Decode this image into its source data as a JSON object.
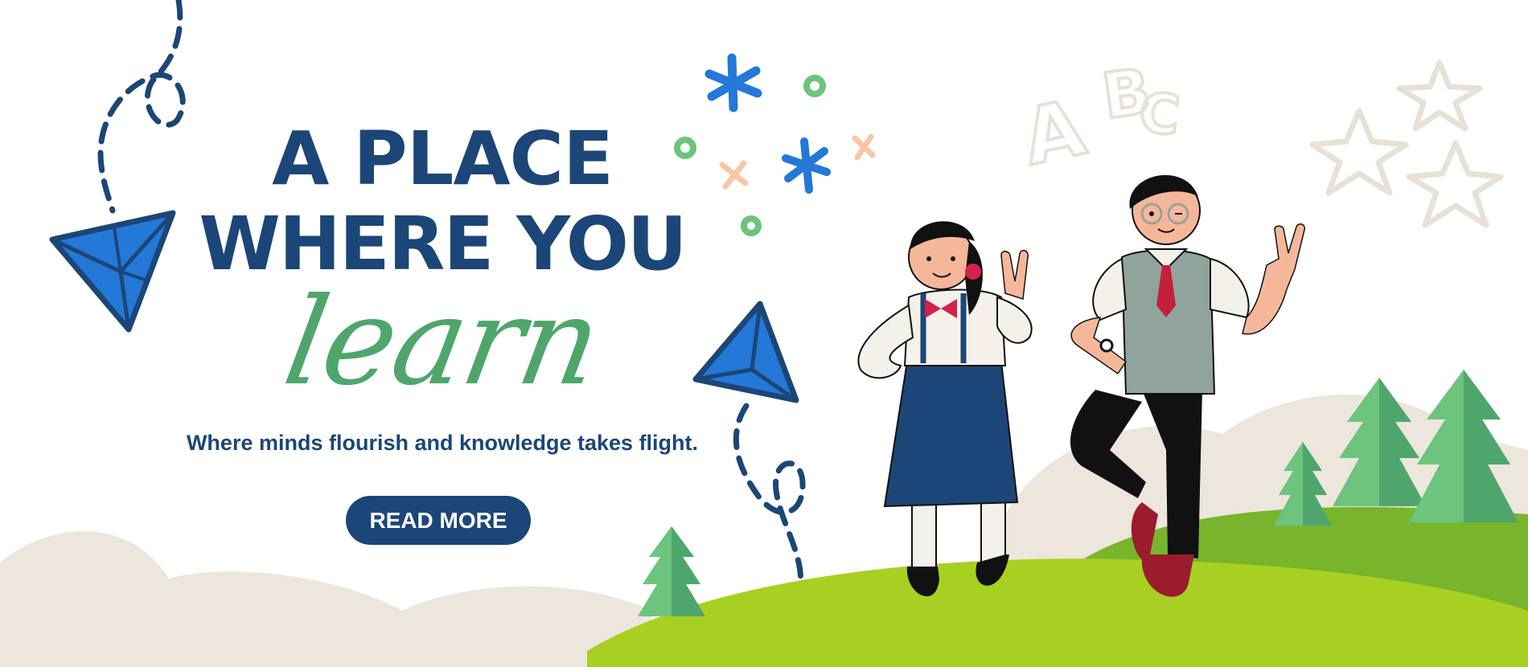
{
  "hero": {
    "headline_line_1": "A PLACE",
    "headline_line_2": "WHERE YOU",
    "headline_script": "learn",
    "tagline": "Where minds flourish and knowledge takes flight.",
    "cta_label": "READ MORE"
  },
  "decor": {
    "letters": [
      "A",
      "B",
      "C"
    ]
  },
  "colors": {
    "primary": "#1b4677",
    "accent_green": "#4fa66d",
    "paper_plane": "#2478d8",
    "hill_light": "#a8d022",
    "hill_dark": "#78b42c",
    "hill_beige": "#ece6dc",
    "star_outline": "#e8e1d8"
  }
}
